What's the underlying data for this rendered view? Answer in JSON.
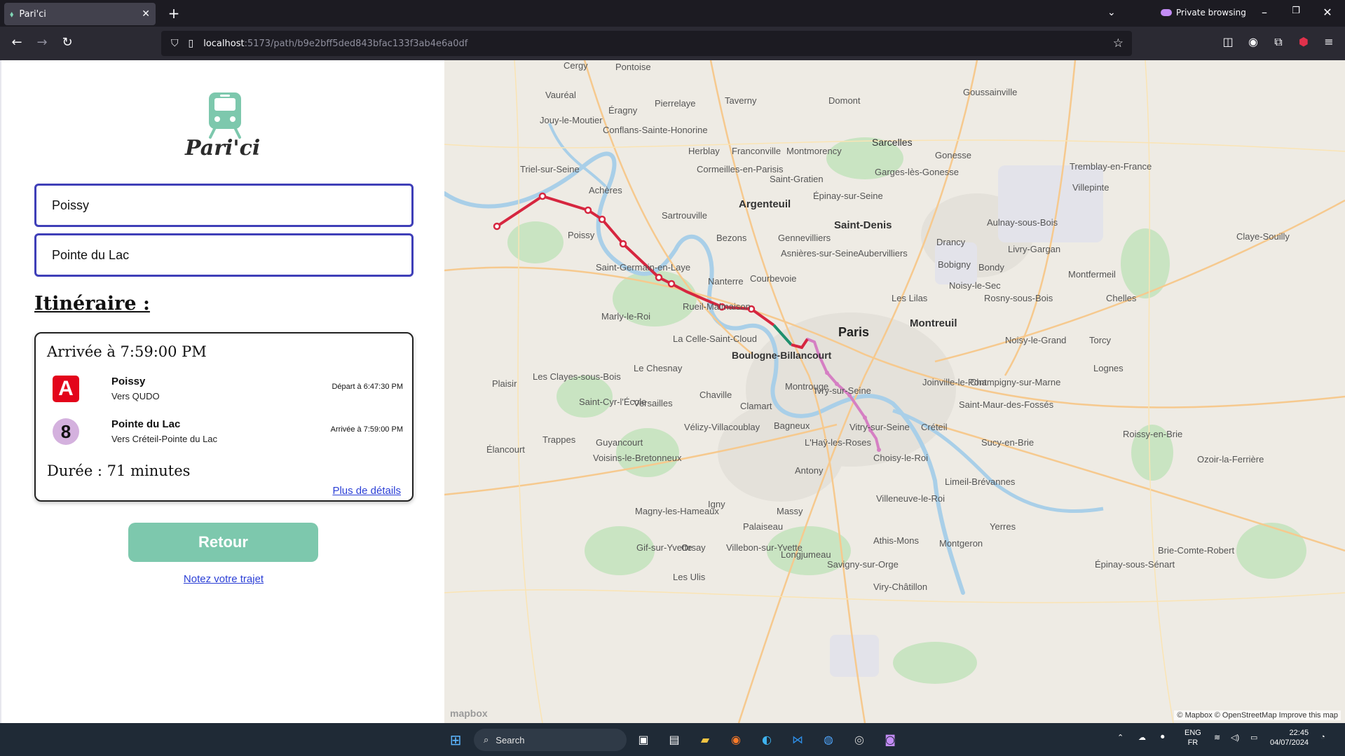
{
  "browser": {
    "tab_title": "Pari'ci",
    "private_label": "Private browsing",
    "url_host": "localhost",
    "url_path": ":5173/path/b9e2bff5ded843bfac133f3ab4e6a0df"
  },
  "app": {
    "logo_text": "Pari'ci",
    "departure_value": "Poissy",
    "arrival_value": "Pointe du Lac",
    "itinerary_heading": "Itinéraire :",
    "arrival_summary": "Arrivée à 7:59:00 PM",
    "legs": [
      {
        "line": "A",
        "line_color": "#e3051b",
        "stop": "Poissy",
        "direction": "Vers QUDO",
        "time": "Départ à 6:47:30 PM"
      },
      {
        "line": "8",
        "line_color": "#d4b1de",
        "stop": "Pointe du Lac",
        "direction": "Vers Créteil-Pointe du Lac",
        "time": "Arrivée à 7:59:00 PM"
      }
    ],
    "duration": "Durée : 71 minutes",
    "details_link": "Plus de détails",
    "back_button": "Retour",
    "rate_link": "Notez votre trajet"
  },
  "map": {
    "attribution": "© Mapbox © OpenStreetMap Improve this map",
    "logo": "mapbox",
    "route_colors": {
      "rer_a": "#d6263f",
      "transfer": "#1f8f6d",
      "metro_8": "#d57fc3"
    },
    "labels": [
      "Cergy",
      "Pontoise",
      "Vauréal",
      "Éragny",
      "Pierrelaye",
      "Taverny",
      "Domont",
      "Sarcelles",
      "Goussainville",
      "Jouy-le-Moutier",
      "Conflans-Sainte-Honorine",
      "Herblay",
      "Franconville",
      "Montmorency",
      "Gonesse",
      "Triel-sur-Seine",
      "Achères",
      "Cormeilles-en-Parisis",
      "Saint-Gratien",
      "Garges-lès-Gonesse",
      "Tremblay-en-France",
      "Argenteuil",
      "Épinay-sur-Seine",
      "Sartrouville",
      "Saint-Denis",
      "Villepinte",
      "Poissy",
      "Bezons",
      "Gennevilliers",
      "Aulnay-sous-Bois",
      "Aubervilliers",
      "Drancy",
      "Livry-Gargan",
      "Saint-Germain-en-Laye",
      "Asnières-sur-Seine",
      "Bobigny",
      "Bondy",
      "Montfermeil",
      "Courbevoie",
      "Nanterre",
      "Noisy-le-Sec",
      "Paris",
      "Montreuil",
      "Les Lilas",
      "Rosny-sous-Bois",
      "Chelles",
      "Rueil-Malmaison",
      "Marly-le-Roi",
      "La Celle-Saint-Cloud",
      "Boulogne-Billancourt",
      "Noisy-le-Grand",
      "Torcy",
      "Le Chesnay",
      "Versailles",
      "Chaville",
      "Ivry-sur-Seine",
      "Joinville-le-Pont",
      "Champigny-sur-Marne",
      "Montrouge",
      "Plaisir",
      "Les Clayes-sous-Bois",
      "Saint-Cyr-l'École",
      "Vélizy-Villacoublay",
      "Clamart",
      "Bagneux",
      "Vitry-sur-Seine",
      "Créteil",
      "Saint-Maur-des-Fossés",
      "Trappes",
      "Guyancourt",
      "L'Haÿ-les-Roses",
      "Choisy-le-Roi",
      "Sucy-en-Brie",
      "Élancourt",
      "Voisins-le-Bretonneux",
      "Antony",
      "Limeil-Brévannes",
      "Magny-les-Hameaux",
      "Igny",
      "Massy",
      "Villeneuve-le-Roi",
      "Palaiseau",
      "Yerres",
      "Gif-sur-Yvette",
      "Orsay",
      "Villebon-sur-Yvette",
      "Longjumeau",
      "Athis-Mons",
      "Montgeron",
      "Les Ulis",
      "Savigny-sur-Orge",
      "Viry-Châtillon",
      "Lognes",
      "Roissy-en-Brie",
      "Ozoir-la-Ferrière",
      "Brie-Comte-Robert",
      "Épinay-sous-Sénart",
      "Claye-Souilly"
    ]
  },
  "taskbar": {
    "search_placeholder": "Search",
    "lang_top": "ENG",
    "lang_bottom": "FR",
    "time": "22:45",
    "date": "04/07/2024"
  }
}
